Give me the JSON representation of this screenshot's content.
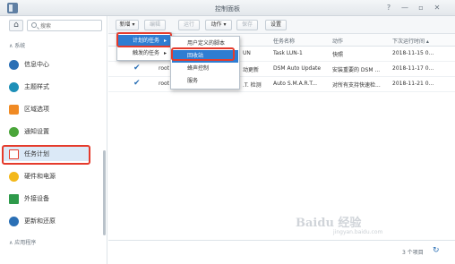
{
  "window": {
    "title": "控制面板",
    "controls": [
      "?",
      "—",
      "▫",
      "✕"
    ]
  },
  "search": {
    "placeholder": "搜索"
  },
  "sidebar": {
    "section_system": "∧ 系统",
    "items": [
      {
        "label": "信息中心",
        "icon": "info-icon",
        "color": "#2a6fb5"
      },
      {
        "label": "主题样式",
        "icon": "palette-icon",
        "color": "#1d8fb8"
      },
      {
        "label": "区域选项",
        "icon": "region-icon",
        "color": "#f08a24"
      },
      {
        "label": "通知设置",
        "icon": "notification-icon",
        "color": "#4aa53a"
      },
      {
        "label": "任务计划",
        "icon": "calendar-icon",
        "color": "#e53b2c"
      },
      {
        "label": "硬件和电源",
        "icon": "bulb-icon",
        "color": "#f3b81a"
      },
      {
        "label": "外接设备",
        "icon": "external-device-icon",
        "color": "#2e9a4a"
      },
      {
        "label": "更新和还原",
        "icon": "update-icon",
        "color": "#2a6fb5"
      }
    ],
    "section_apps": "∧ 应用程序"
  },
  "toolbar": {
    "create": "新增 ▾",
    "edit": "编辑",
    "run": "运行",
    "action": "动作 ▾",
    "save": "保存",
    "settings": "设置"
  },
  "table": {
    "headers": {
      "name": "任务名称",
      "action": "动作",
      "next_run": "下次运行时间 ▴"
    },
    "rows": [
      {
        "checked": false,
        "user": "",
        "task_tail": "UN",
        "name": "Task LUN-1",
        "action": "快照",
        "next_run": "2018-11-15 0..."
      },
      {
        "checked": true,
        "user": "root",
        "task_tail": "动更新",
        "name": "DSM Auto Update",
        "action": "安装重要的 DSM ...",
        "next_run": "2018-11-17 0..."
      },
      {
        "checked": true,
        "user": "root",
        "task_tail": ".T. 检测",
        "name": "Auto S.M.A.R.T...",
        "action": "对所有支持快速检...",
        "next_run": "2018-11-21 0..."
      }
    ]
  },
  "menu_create": {
    "items": [
      {
        "label": "计划的任务",
        "arrow": "▸"
      },
      {
        "label": "触发的任务",
        "arrow": "▸"
      }
    ]
  },
  "menu_scheduled": {
    "items": [
      "用户定义的脚本",
      "回收站",
      "蜂声控制",
      "服务"
    ]
  },
  "footer": {
    "count": "3 个项目",
    "refresh": "↻"
  },
  "highlight_color": "#e53b2c",
  "watermark": {
    "brand": "Baidu 经验",
    "url": "jingyan.baidu.com"
  }
}
